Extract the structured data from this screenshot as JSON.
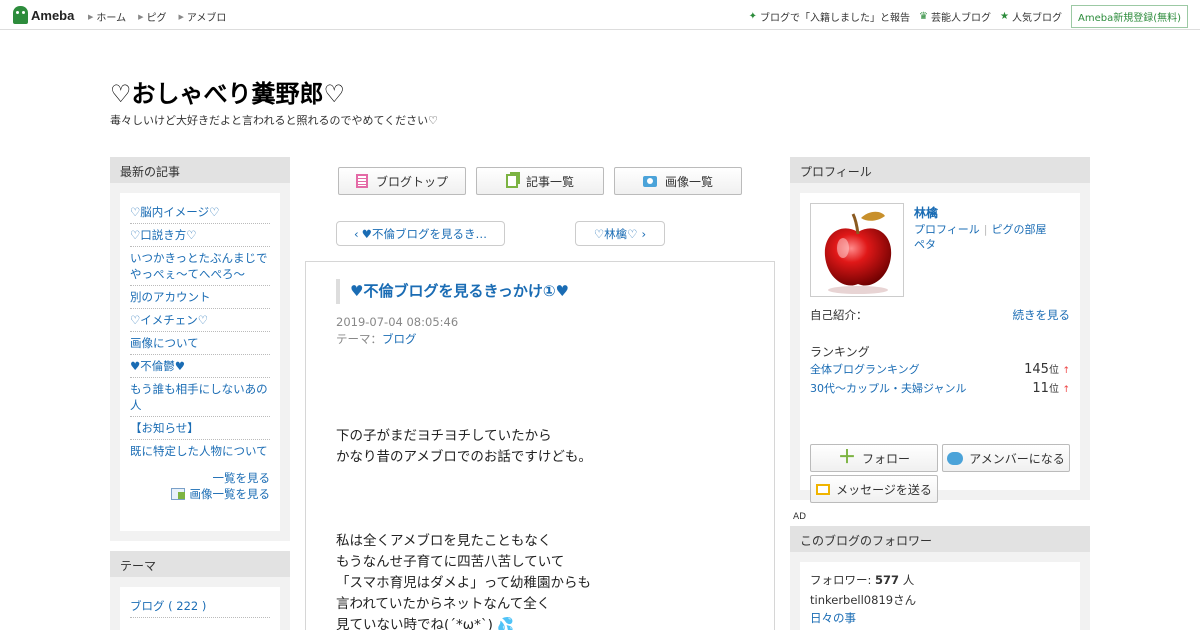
{
  "header": {
    "logo_text": "Ameba",
    "nav": [
      "ホーム",
      "ピグ",
      "アメブロ"
    ],
    "right_links": [
      "ブログで「入籍しました」と報告",
      "芸能人ブログ",
      "人気ブログ"
    ],
    "signup_label": "Ameba新規登録(無料)"
  },
  "blog": {
    "title": "♡おしゃべり糞野郎♡",
    "description": "毒々しいけど大好きだよと言われると照れるのでやめてください♡"
  },
  "left": {
    "latest_heading": "最新の記事",
    "latest_items": [
      "♡脳内イメージ♡",
      "♡口説き方♡",
      "いつかきっとたぶんまじでやっぺぇ～てへぺろ～",
      "別のアカウント",
      "♡イメチェン♡",
      "画像について",
      "♥不倫鬱♥",
      "もう誰も相手にしないあの人",
      "【お知らせ】",
      "既に特定した人物について"
    ],
    "see_list": "一覧を見る",
    "see_images": "画像一覧を見る",
    "theme_heading": "テーマ",
    "theme_item": "ブログ ( 222 )"
  },
  "center": {
    "tabs": [
      "ブログトップ",
      "記事一覧",
      "画像一覧"
    ],
    "prev_label": "♥不倫ブログを見るき…",
    "next_label": "♡林檎♡",
    "article": {
      "title": "♥不倫ブログを見るきっかけ①♥",
      "date": "2019-07-04 08:05:46",
      "theme_prefix": "テーマ：",
      "theme_link": "ブログ",
      "para1": [
        "下の子がまだヨチヨチしていたから",
        "かなり昔のアメブロでのお話ですけども。"
      ],
      "para2": [
        "私は全くアメブロを見たこともなく",
        "もうなんせ子育てに四苦八苦していて",
        "「スマホ育児はダメよ」って幼稚園からも",
        "言われていたからネットなんて全く",
        "見ていない時でね(´*ω*`)"
      ],
      "emoji": "💦"
    }
  },
  "right": {
    "profile_heading": "プロフィール",
    "name": "林檎",
    "profile_link": "プロフィール",
    "pig_link": "ピグの部屋",
    "peta_link": "ペタ",
    "intro_label": "自己紹介：",
    "intro_more": "続きを見る",
    "ranking_heading": "ランキング",
    "rankings": [
      {
        "label": "全体ブログランキング",
        "value": "145",
        "unit": "位",
        "arrow": "↑"
      },
      {
        "label": "30代〜カップル・夫婦ジャンル",
        "value": "11",
        "unit": "位",
        "arrow": "↑"
      }
    ],
    "follow_label": "フォロー",
    "amember_label": "アメンバーになる",
    "message_label": "メッセージを送る",
    "ad_label": "AD",
    "followers_heading": "このブログのフォロワー",
    "followers_prefix": "フォロワー:",
    "followers_count": "577",
    "followers_unit": "人",
    "follower_user": "tinkerbell0819さん",
    "follower_blog": "日々の事"
  },
  "colors": {
    "brand_green": "#2d8c3c",
    "link_blue": "#1a6cb4",
    "rank_up": "#ee4444"
  }
}
